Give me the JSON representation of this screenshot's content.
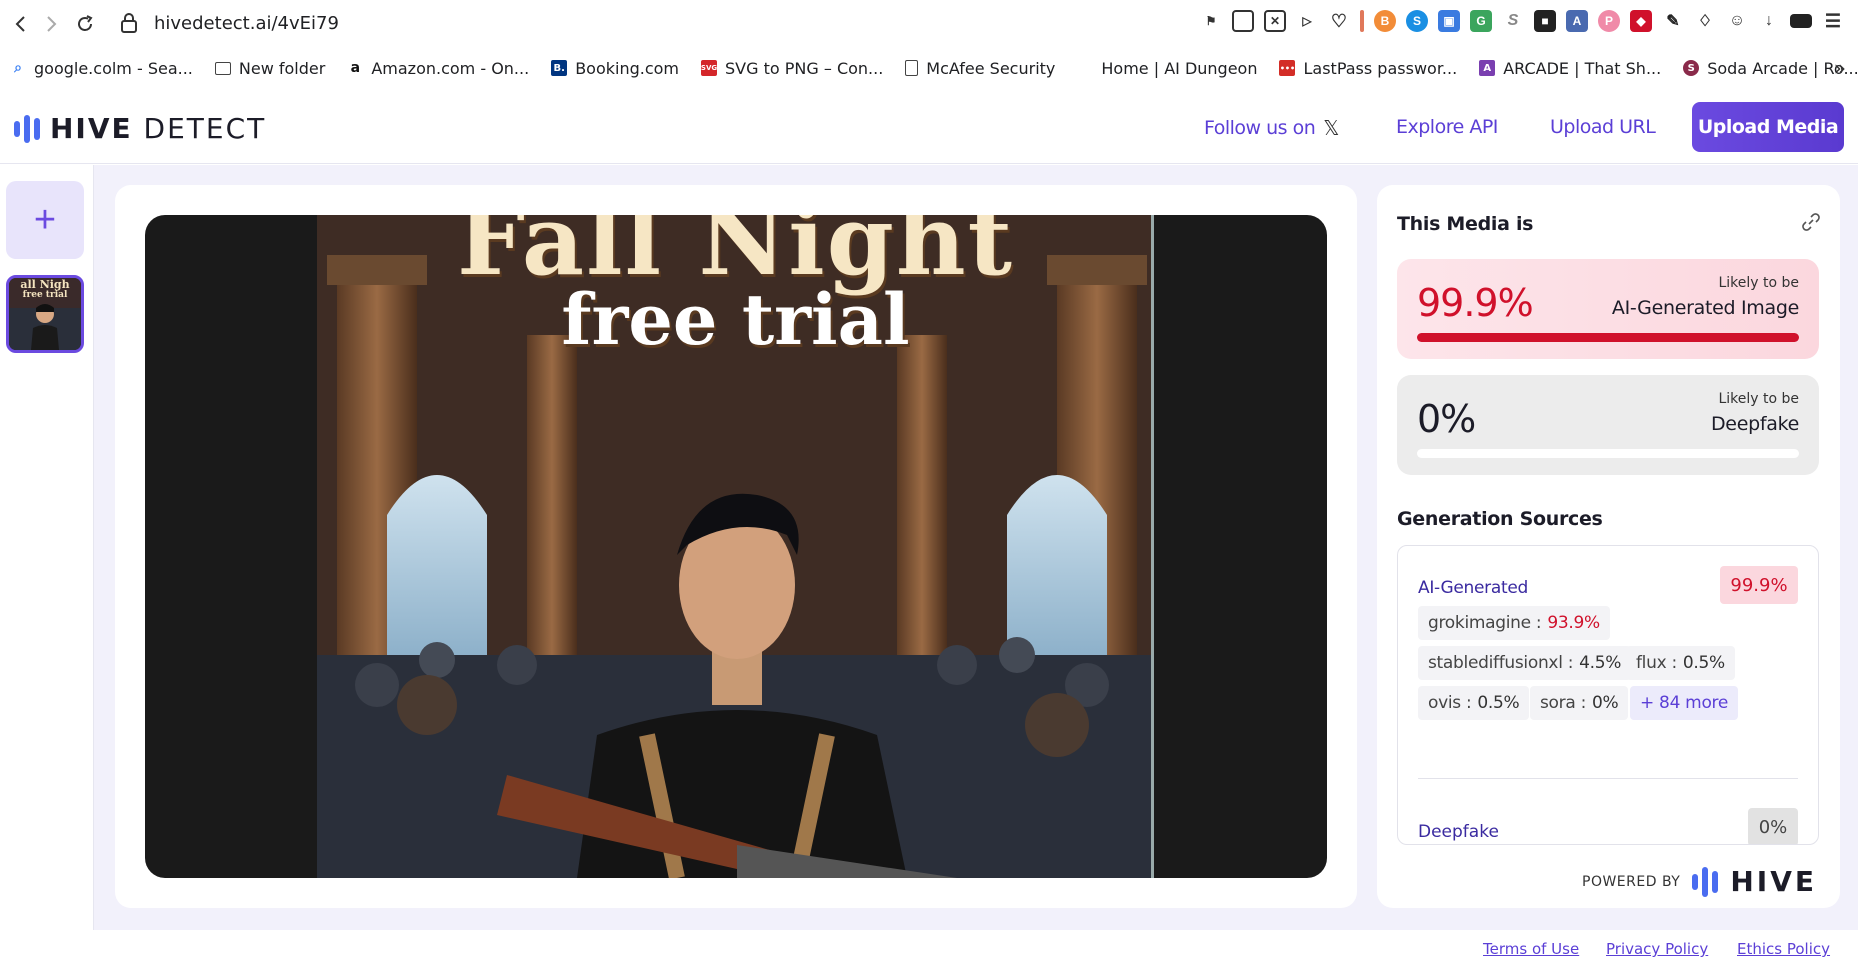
{
  "browser": {
    "url": "hivedetect.ai/4vEi79"
  },
  "bookmarks": [
    {
      "label": "google.colm - Sea...",
      "icon": "search-icon",
      "color": "#4285f4"
    },
    {
      "label": "New folder",
      "icon": "folder-icon",
      "color": "#444444"
    },
    {
      "label": "Amazon.com - On...",
      "icon": "amazon-icon",
      "color": "#111111"
    },
    {
      "label": "Booking.com",
      "icon": "booking-icon",
      "color": "#003580"
    },
    {
      "label": "SVG to PNG – Con...",
      "icon": "svgpng-icon",
      "color": "#d4262a"
    },
    {
      "label": "McAfee Security",
      "icon": "document-icon",
      "color": "#444444"
    },
    {
      "label": "Home | AI Dungeon",
      "icon": "aidungeon-icon",
      "color": "#ffffff"
    },
    {
      "label": "LastPass passwor...",
      "icon": "lastpass-icon",
      "color": "#d32d27"
    },
    {
      "label": "ARCADE | That Sh...",
      "icon": "arcade-icon",
      "color": "#7a3fb0"
    },
    {
      "label": "Soda Arcade | Ro...",
      "icon": "soda-icon",
      "color": "#8a2a4a"
    }
  ],
  "header": {
    "logo_word_bold": "HIVE",
    "logo_word_rest": " DETECT",
    "follow_label": "Follow us on",
    "explore_api_label": "Explore API",
    "upload_url_label": "Upload URL",
    "upload_media_label": "Upload Media"
  },
  "sidebar": {
    "add_label": "+"
  },
  "media": {
    "poster_title_line1": "Fall Night",
    "poster_title_line2": "free trial",
    "thumb_title_line1": "all Nigh",
    "thumb_title_line2": "free trial"
  },
  "results": {
    "title": "This Media is",
    "ai": {
      "percent": "99.9%",
      "percent_value": 99.9,
      "likely_label": "Likely to be",
      "likely_value": "AI-Generated Image"
    },
    "deepfake": {
      "percent": "0%",
      "percent_value": 0,
      "likely_label": "Likely to be",
      "likely_value": "Deepfake"
    },
    "generation_title": "Generation Sources",
    "ai_generated_label": "AI-Generated",
    "ai_generated_badge": "99.9%",
    "sources": [
      {
        "name": "grokimagine :",
        "value": "93.9%",
        "highlight": true
      },
      {
        "name": "stablediffusionxl :",
        "value": "4.5%",
        "highlight": false
      },
      {
        "name": "flux :",
        "value": "0.5%",
        "highlight": false
      },
      {
        "name": "ovis :",
        "value": "0.5%",
        "highlight": false
      },
      {
        "name": "sora :",
        "value": "0%",
        "highlight": false
      }
    ],
    "more_label": "+ 84 more",
    "deepfake_label": "Deepfake",
    "deepfake_badge": "0%",
    "powered_by": "POWERED BY",
    "hive_word": "HIVE"
  },
  "footer": {
    "terms": "Terms of Use",
    "privacy": "Privacy Policy",
    "ethics": "Ethics Policy"
  },
  "colors": {
    "accent": "#5b3fd6",
    "ai_red": "#d0112b",
    "logo_blue": "#4a6cf0"
  }
}
